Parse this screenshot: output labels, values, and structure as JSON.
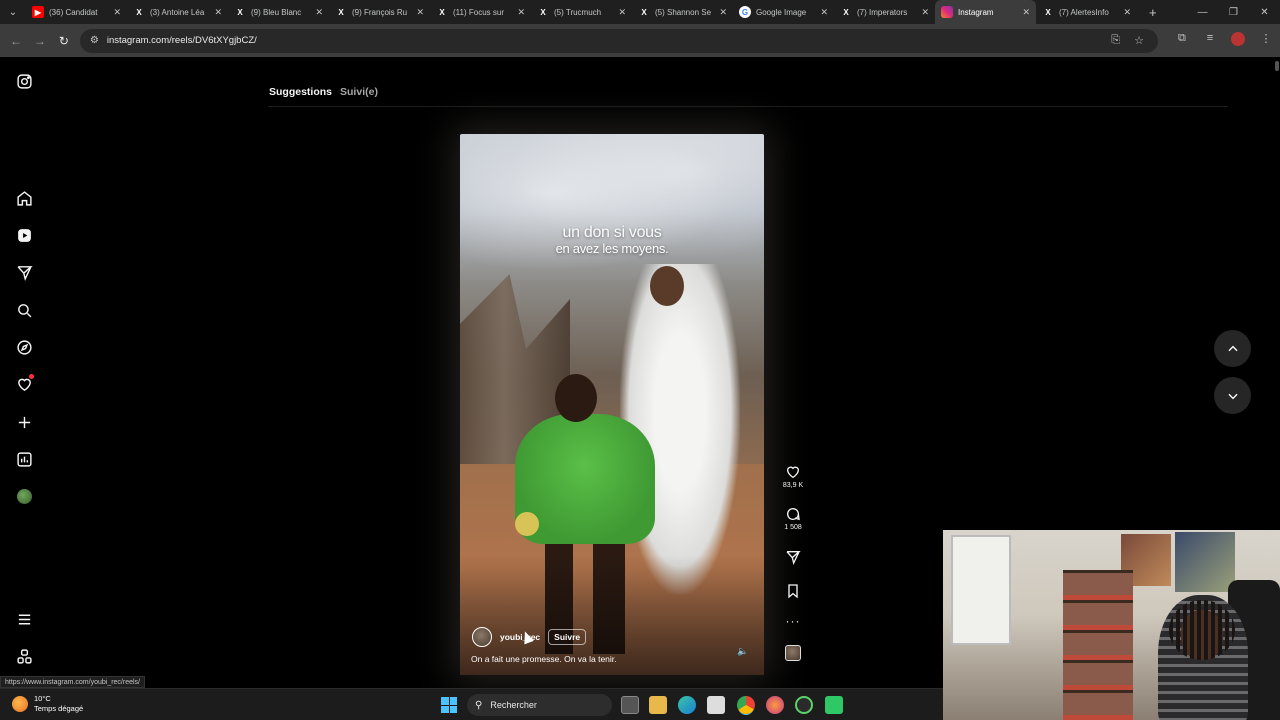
{
  "browser": {
    "tabs": [
      {
        "title": "(36) Candidat",
        "icon": "youtube-icon",
        "active": false
      },
      {
        "title": "(3) Antoine Léa",
        "icon": "x-icon",
        "active": false
      },
      {
        "title": "(9) Bleu Blanc",
        "icon": "x-icon",
        "active": false
      },
      {
        "title": "(9) François Ru",
        "icon": "x-icon",
        "active": false
      },
      {
        "title": "(11) Focus sur",
        "icon": "x-icon",
        "active": false
      },
      {
        "title": "(5) Trucmuch",
        "icon": "x-icon",
        "active": false
      },
      {
        "title": "(5) Shannon Se",
        "icon": "x-icon",
        "active": false
      },
      {
        "title": "Google Image",
        "icon": "google-icon",
        "active": false
      },
      {
        "title": "(7) Imperators",
        "icon": "x-icon",
        "active": false
      },
      {
        "title": "Instagram",
        "icon": "instagram-icon",
        "active": true
      },
      {
        "title": "(7) AlertesInfo",
        "icon": "x-icon",
        "active": false
      }
    ],
    "url": "instagram.com/reels/DV6tXYgjbCZ/",
    "status_url": "https://www.instagram.com/youbi_rec/reels/"
  },
  "instagram": {
    "feed_tabs": [
      {
        "label": "Suggestions",
        "active": true
      },
      {
        "label": "Suivi(e)",
        "active": false
      }
    ],
    "reel": {
      "overlay_line1": "un don si vous",
      "overlay_line2": "en avez les moyens.",
      "author": "youbi_rec",
      "follow_label": "Suivre",
      "description": "On a fait une promesse. On va la tenir.",
      "likes": "83,9 K",
      "comments": "1 508"
    }
  },
  "taskbar": {
    "temperature": "10°C",
    "weather_desc": "Temps dégagé",
    "search_placeholder": "Rechercher"
  },
  "colors": {
    "accent_blue": "#4cc2ff",
    "notification_red": "#ff3040",
    "page_bg": "#000000"
  }
}
